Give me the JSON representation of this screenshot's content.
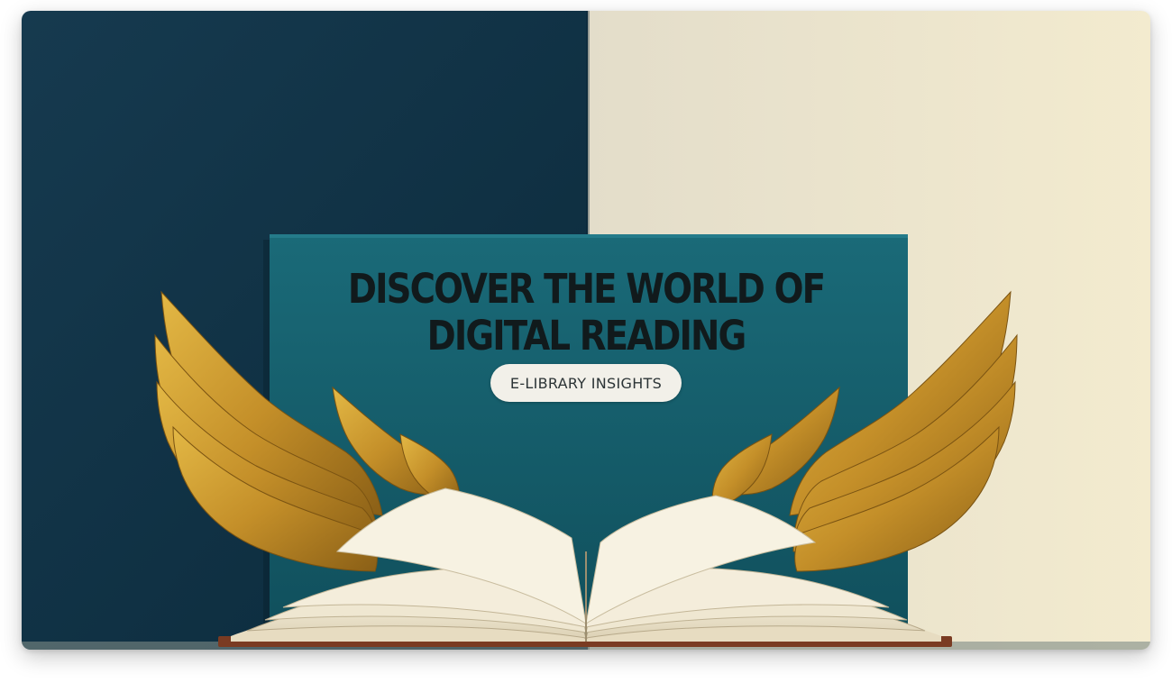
{
  "hero": {
    "headline_line1": "DISCOVER THE WORLD OF",
    "headline_line2": "DIGITAL READING",
    "badge_label": "E-LIBRARY INSIGHTS",
    "image_description_icon": "open-book-with-golden-wings-illustration"
  },
  "colors": {
    "left_wall": "#10334a",
    "right_wall": "#ede6cf",
    "panel": "#145e6c",
    "wing_gold": "#c9982e",
    "page_cream": "#f1ead7",
    "headline_text": "#111a1c",
    "badge_bg": "#f2f0e9"
  }
}
